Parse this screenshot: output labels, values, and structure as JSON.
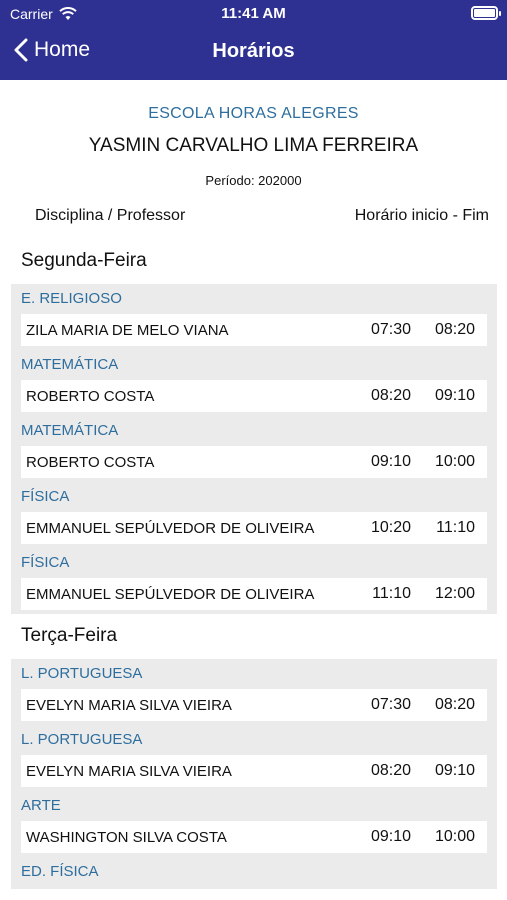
{
  "status_bar": {
    "carrier": "Carrier",
    "time": "11:41 AM"
  },
  "nav": {
    "back_label": "Home",
    "title": "Horários"
  },
  "info": {
    "school": "ESCOLA HORAS  ALEGRES",
    "student": "YASMIN CARVALHO LIMA FERREIRA",
    "period": "Período: 202000"
  },
  "columns": {
    "left": "Disciplina / Professor",
    "right": "Horário inicio - Fim"
  },
  "days": [
    {
      "name": "Segunda-Feira",
      "entries": [
        {
          "subject": "E. RELIGIOSO",
          "teacher": "ZILA MARIA DE MELO VIANA",
          "start": "07:30",
          "end": "08:20"
        },
        {
          "subject": "MATEMÁTICA",
          "teacher": "ROBERTO COSTA",
          "start": "08:20",
          "end": "09:10"
        },
        {
          "subject": "MATEMÁTICA",
          "teacher": "ROBERTO COSTA",
          "start": "09:10",
          "end": "10:00"
        },
        {
          "subject": "FÍSICA",
          "teacher": "EMMANUEL SEPÚLVEDOR DE OLIVEIRA",
          "start": "10:20",
          "end": "11:10"
        },
        {
          "subject": "FÍSICA",
          "teacher": "EMMANUEL SEPÚLVEDOR DE OLIVEIRA",
          "start": "11:10",
          "end": "12:00"
        }
      ]
    },
    {
      "name": "Terça-Feira",
      "entries": [
        {
          "subject": "L. PORTUGUESA",
          "teacher": "EVELYN MARIA SILVA VIEIRA",
          "start": "07:30",
          "end": "08:20"
        },
        {
          "subject": "L. PORTUGUESA",
          "teacher": "EVELYN MARIA SILVA VIEIRA",
          "start": "08:20",
          "end": "09:10"
        },
        {
          "subject": "ARTE",
          "teacher": "WASHINGTON SILVA COSTA",
          "start": "09:10",
          "end": "10:00"
        },
        {
          "subject": "ED. FÍSICA",
          "teacher": "",
          "start": "",
          "end": ""
        }
      ]
    }
  ],
  "colors": {
    "header": "#2f3192",
    "subject": "#2e6e9e",
    "block_bg": "#ebebeb"
  }
}
